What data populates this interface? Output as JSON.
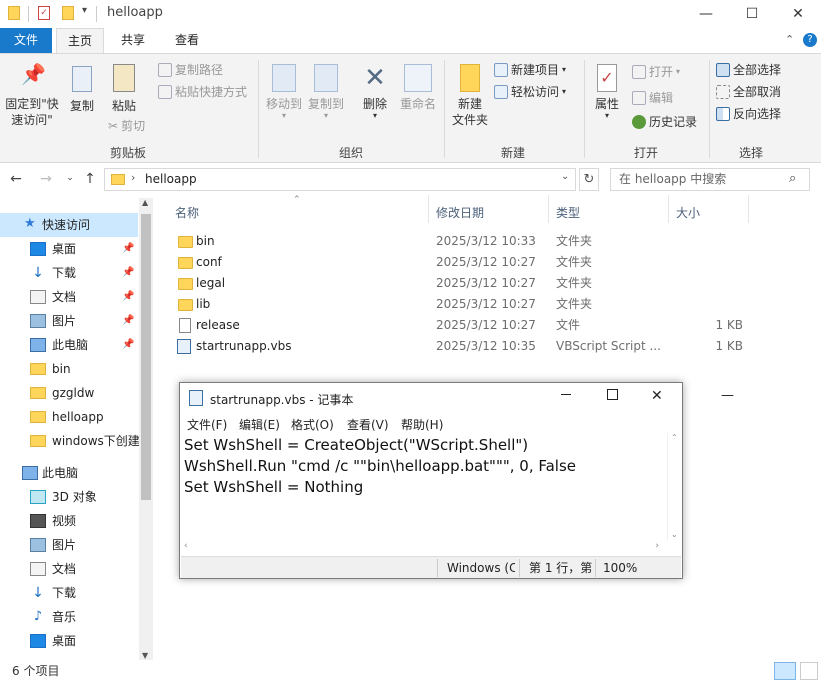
{
  "window": {
    "title": "helloapp",
    "minimize": "—",
    "maximize": "☐",
    "close": "✕"
  },
  "tabs": [
    "文件",
    "主页",
    "共享",
    "查看"
  ],
  "ribbon": {
    "pin": "固定到\"快\n速访问\"",
    "copy": "复制",
    "paste": "粘贴",
    "copy_path": "复制路径",
    "paste_shortcut": "粘贴快捷方式",
    "cut": "剪切",
    "clipboard": "剪贴板",
    "move_to": "移动到",
    "copy_to": "复制到",
    "delete": "删除",
    "rename": "重命名",
    "organize": "组织",
    "new_folder": "新建\n文件夹",
    "new_item": "新建项目",
    "easy_access": "轻松访问",
    "new": "新建",
    "properties": "属性",
    "open": "打开",
    "edit": "编辑",
    "history": "历史记录",
    "open_group": "打开",
    "select_all": "全部选择",
    "select_none": "全部取消",
    "invert": "反向选择",
    "select": "选择"
  },
  "address": {
    "path": "helloapp",
    "search_placeholder": "在 helloapp 中搜索"
  },
  "nav": {
    "quick_access": "快速访问",
    "items": [
      {
        "label": "桌面",
        "pinned": true,
        "icon": "desktop-icon"
      },
      {
        "label": "下载",
        "pinned": true,
        "icon": "download-icon"
      },
      {
        "label": "文档",
        "pinned": true,
        "icon": "document-icon"
      },
      {
        "label": "图片",
        "pinned": true,
        "icon": "picture-icon"
      },
      {
        "label": "此电脑",
        "pinned": true,
        "icon": "computer-icon"
      },
      {
        "label": "bin",
        "pinned": false,
        "icon": "folder-icon"
      },
      {
        "label": "gzgldw",
        "pinned": false,
        "icon": "folder-icon"
      },
      {
        "label": "helloapp",
        "pinned": false,
        "icon": "folder-icon"
      },
      {
        "label": "windows下创建",
        "pinned": false,
        "icon": "folder-icon"
      }
    ],
    "this_pc": "此电脑",
    "pc_items": [
      {
        "label": "3D 对象",
        "icon": "3d-objects-icon"
      },
      {
        "label": "视频",
        "icon": "video-icon"
      },
      {
        "label": "图片",
        "icon": "picture-icon"
      },
      {
        "label": "文档",
        "icon": "document-icon"
      },
      {
        "label": "下载",
        "icon": "download-icon"
      },
      {
        "label": "音乐",
        "icon": "music-icon"
      },
      {
        "label": "桌面",
        "icon": "desktop-icon"
      }
    ]
  },
  "columns": {
    "name": "名称",
    "modified": "修改日期",
    "type": "类型",
    "size": "大小"
  },
  "files": [
    {
      "name": "bin",
      "modified": "2025/3/12 10:33",
      "type": "文件夹",
      "size": "",
      "kind": "folder"
    },
    {
      "name": "conf",
      "modified": "2025/3/12 10:27",
      "type": "文件夹",
      "size": "",
      "kind": "folder"
    },
    {
      "name": "legal",
      "modified": "2025/3/12 10:27",
      "type": "文件夹",
      "size": "",
      "kind": "folder"
    },
    {
      "name": "lib",
      "modified": "2025/3/12 10:27",
      "type": "文件夹",
      "size": "",
      "kind": "folder"
    },
    {
      "name": "release",
      "modified": "2025/3/12 10:27",
      "type": "文件",
      "size": "1 KB",
      "kind": "file"
    },
    {
      "name": "startrunapp.vbs",
      "modified": "2025/3/12 10:35",
      "type": "VBScript Script ...",
      "size": "1 KB",
      "kind": "vbs"
    }
  ],
  "status": {
    "count": "6 个项目"
  },
  "notepad": {
    "title": "startrunapp.vbs - 记事本",
    "menu": [
      "文件(F)",
      "编辑(E)",
      "格式(O)",
      "查看(V)",
      "帮助(H)"
    ],
    "content": "Set WshShell = CreateObject(\"WScript.Shell\")\nWshShell.Run \"cmd /c \"\"bin\\helloapp.bat\"\"\", 0, False\nSet WshShell = Nothing",
    "encoding": "Windows (C",
    "position": "第 1 行，第",
    "zoom": "100%"
  }
}
